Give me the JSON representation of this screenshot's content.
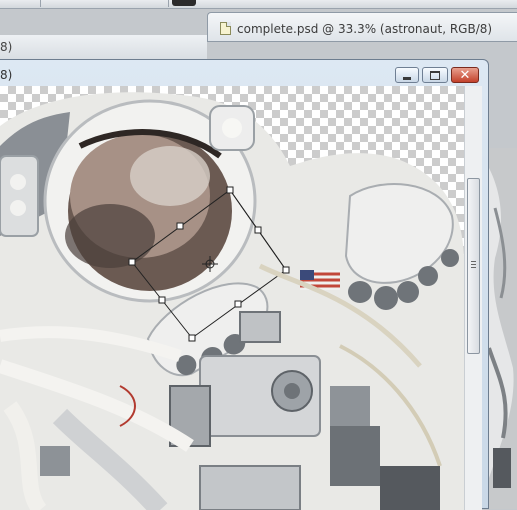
{
  "background_document": {
    "title": "complete.psd @ 33.3% (astronaut, RGB/8)",
    "icon": "document-icon"
  },
  "back_window": {
    "title_fragment": "8)"
  },
  "document_window": {
    "title_fragment": "8)",
    "controls": {
      "minimize": "minimize-icon",
      "maximize": "maximize-icon",
      "close": "close-icon"
    },
    "canvas": {
      "layer": "astronaut",
      "transform": "free-transform-bounding-box"
    },
    "scrollbar": {
      "orientation": "vertical"
    }
  },
  "colors": {
    "title_text": "#3c3c3c",
    "window_frame": "#c9d8e7",
    "close_button": "#c3412b",
    "transparency_checker": "#cccccc"
  }
}
